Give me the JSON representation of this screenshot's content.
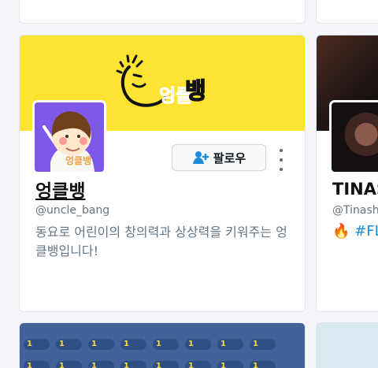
{
  "profile": {
    "name": "엉클뱅",
    "handle": "@uncle_bang",
    "bio": "동요로 어린이의 창의력과 상상력을 키워주는 엉클뱅입니다!",
    "follow_label": "팔로우",
    "logo_text": "엉클뱅"
  },
  "next_profile": {
    "name": "TINAS",
    "handle": "@Tinash",
    "bio": "🔥 #FL"
  },
  "bottom": {
    "chip_label": "1"
  },
  "colors": {
    "banner": "#fde433",
    "avatar_bg": "#7e58e8",
    "link_blue": "#1b8be0"
  }
}
